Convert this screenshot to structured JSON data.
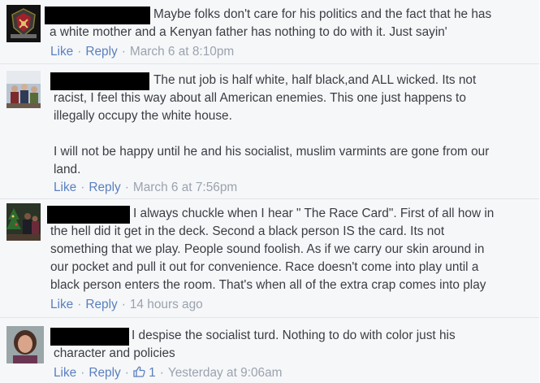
{
  "comments": [
    {
      "lines": [
        "Maybe folks don't care for his politics and the fact that he has",
        "a white mother and a Kenyan father has nothing to do with it. Just sayin'"
      ],
      "actions": {
        "like": "Like",
        "reply": "Reply"
      },
      "timestamp": "March 6 at 8:10pm"
    },
    {
      "lines": [
        "The nut job is half white, half black,and ALL wicked. Its not",
        "racist, I feel this way about all American enemies. This one just happens to",
        "illegally occupy the white house.",
        "",
        "I will not be happy until he and his socialist, muslim varmints are gone from our",
        "land."
      ],
      "actions": {
        "like": "Like",
        "reply": "Reply"
      },
      "timestamp": "March 6 at 7:56pm"
    },
    {
      "lines": [
        "I always chuckle when I hear \" The Race Card\". First of all how in",
        "the hell did it get in the deck. Second a black person IS the card. Its not",
        "something that we play. People sound foolish. As if we carry our skin around in",
        "our pocket and pull it out for convenience. Race doesn't come into play until a",
        "black person enters the room. That's when all of the extra crap comes into play"
      ],
      "actions": {
        "like": "Like",
        "reply": "Reply"
      },
      "timestamp": "14 hours ago"
    },
    {
      "lines": [
        "I despise the socialist turd. Nothing to do with color just his",
        "character and policies"
      ],
      "actions": {
        "like": "Like",
        "reply": "Reply"
      },
      "like_count": "1",
      "like_icon": "thumbs-up-icon",
      "timestamp": "Yesterday at 9:06am"
    }
  ],
  "colors": {
    "background": "#f6f7f9",
    "link": "#5a7fbf",
    "text": "#3a3d42",
    "meta": "#9ba3ae",
    "redaction": "#000000"
  }
}
